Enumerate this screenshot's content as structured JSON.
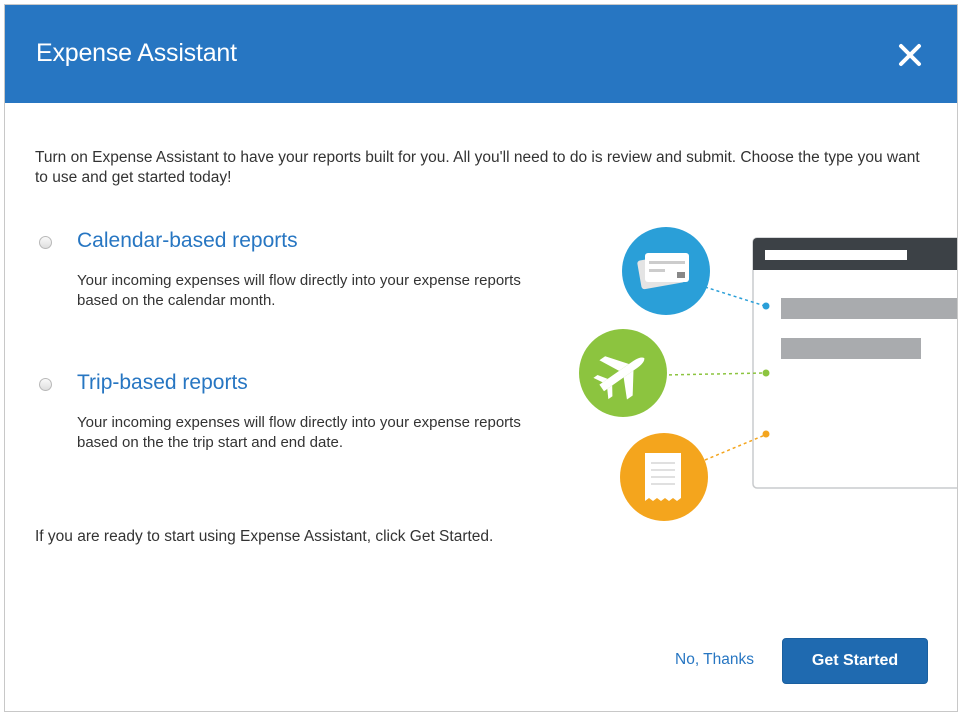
{
  "dialog": {
    "title": "Expense Assistant",
    "close_icon": "close-icon",
    "intro": "Turn on Expense Assistant to have your reports built for you. All you'll need to do is review and submit. Choose the type you want to use and get started today!",
    "options": [
      {
        "title": "Calendar-based reports",
        "description": "Your incoming expenses will flow directly into your expense reports based on the calendar month.",
        "selected": false
      },
      {
        "title": "Trip-based reports",
        "description": "Your incoming expenses will flow directly into your expense reports based on the the trip start and end date.",
        "selected": false
      }
    ],
    "footer_text": "If you are ready to start using Expense Assistant, click Get Started.",
    "buttons": {
      "no_thanks": "No, Thanks",
      "get_started": "Get Started"
    }
  },
  "illustration": {
    "icons": [
      "credit-card-icon",
      "airplane-icon",
      "receipt-icon"
    ],
    "colors": {
      "card": "#2a9fd8",
      "plane": "#8cc43f",
      "receipt": "#f4a51d",
      "header_bar": "#3c4146"
    }
  },
  "colors": {
    "header": "#2776c2",
    "primary_button": "#1f6ab0",
    "link": "#2776c2"
  }
}
